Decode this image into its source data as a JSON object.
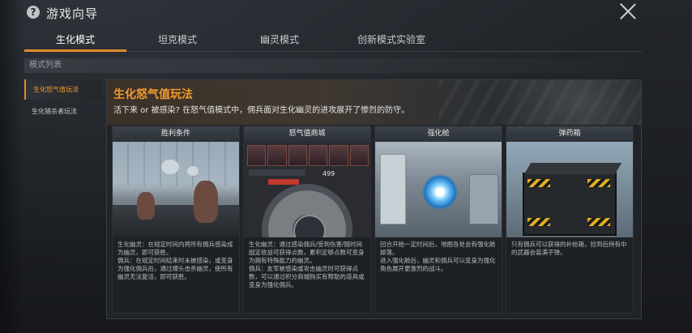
{
  "window": {
    "title": "游戏向导"
  },
  "tabs": [
    {
      "label": "生化模式",
      "active": true
    },
    {
      "label": "坦克模式",
      "active": false
    },
    {
      "label": "幽灵模式",
      "active": false
    },
    {
      "label": "创新模式实验室",
      "active": false
    }
  ],
  "section_label": "模式列表",
  "sidebar": {
    "items": [
      {
        "label": "生化怒气值玩法",
        "active": true
      },
      {
        "label": "生化猎杀者玩法",
        "active": false
      }
    ]
  },
  "main": {
    "title": "生化怒气值玩法",
    "subtitle": "活下来 or 被感染? 在怒气值模式中，佣兵面对生化幽灵的进攻展开了惨烈的防守。",
    "cards": [
      {
        "title": "胜利条件",
        "desc": "生化幽灵：在规定时间内将所有佣兵感染成为幽灵，即可获胜。\n佣兵：在规定时间结束时未被感染，或变身为强化佣兵后，通过爆头击杀幽灵，使所有幽灵无法复活，即可获胜。"
      },
      {
        "title": "怒气值商城",
        "desc": "生化幽灵：通过感染佣兵/受到伤害/随时间固定收益可获得点数，累积足够点数可变身为拥有特殊能力的幽灵。\n佣兵：友军被感染或攻击幽灵时可获得点数，可以通过积分商城购买有帮助的道具或变身为强化佣兵。",
        "shop_value": "499"
      },
      {
        "title": "强化舱",
        "desc": "回合开始一定时间后，地图各处会有强化舱掉落。\n进入强化舱后，幽灵和佣兵可以变身为强化角色展开更激烈的战斗。"
      },
      {
        "title": "弹药箱",
        "desc": "只有佣兵可以获得的补给箱，捡到后持有中的武器会装满子弹。"
      }
    ]
  },
  "colors": {
    "accent": "#e08a2a",
    "title_orange": "#f19a2e"
  }
}
